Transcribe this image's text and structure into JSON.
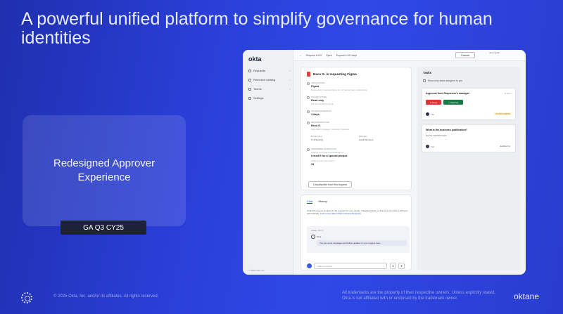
{
  "headline": "A powerful unified platform to simplify governance for human identities",
  "feature_card": {
    "title": "Redesigned Approver Experience",
    "badge": "GA Q3 CY25"
  },
  "footer": {
    "copyright": "© 2025 Okta, Inc. and/or its affiliates. All rights reserved.",
    "trademark": "All trademarks are the property of their respective owners. Unless explicitly stated, Okta is not affiliated with or endorsed by the trademark owner.",
    "brand": "oktane"
  },
  "app": {
    "logo": "okta",
    "nav": [
      {
        "label": "Requests"
      },
      {
        "label": "Resource catalog"
      },
      {
        "label": "Teams"
      },
      {
        "label": "Settings"
      }
    ],
    "side_footer": "© 2025 Okta, Inc.",
    "topbar": {
      "back": "←",
      "request_id": "Request #123",
      "status": "Open",
      "expires": "Expires in 30 days",
      "cancel": "Cancel",
      "user": "Jane Smith"
    },
    "request": {
      "title": "Beca G. is requesting Figma",
      "fields": [
        {
          "label": "APPLICATION",
          "value": "Figma",
          "sub": "Requesting to access figma for our design team onboarding"
        },
        {
          "label": "ACCESS LEVEL",
          "value": "Read only",
          "sub": "For the contractor group"
        },
        {
          "label": "ACCESS DURATION",
          "value": "3 days",
          "sub": ""
        },
        {
          "label": "REQUESTED FOR",
          "value": "Beca G.",
          "sub": "Web Editor manager, Customer Success"
        }
      ],
      "department_label": "Department",
      "department_value": "IT & Security",
      "manager_label": "Manager",
      "manager_value": "Anna Simmons",
      "questions_label": "ANSWERED QUESTIONS",
      "q1": "What is your business justification?",
      "a1": "I need it for a special project.",
      "q2": "What is your cost center?",
      "a2": "31",
      "unsubscribe": "Unsubscribe from this request"
    },
    "chat": {
      "tab_chat": "Chat",
      "tab_history": "History",
      "description": "Chat with anyone involved in the request for more details. Integrated Slack or Teams conversations will sync automatically.",
      "link": "Learn more about Chat in Access Requests",
      "date": "Friday, Oct 3",
      "author": "Okta",
      "message": "You can send messages and follow updates to your request here.",
      "input_placeholder": "Add a comment",
      "attach": "$",
      "send": "➤"
    },
    "tasks": {
      "title": "Tasks",
      "only_mine": "Show only tasks assigned to you",
      "items": [
        {
          "title": "Approval from Requester's manager",
          "due": "6 Oct 7",
          "deny": "✕ Deny",
          "approve": "✓ Approve",
          "assignee": "You",
          "status": "IN PROGRESS"
        },
        {
          "title": "What is the business justification?",
          "question": "For the special project.",
          "assignee": "You",
          "status": "Justified by"
        }
      ]
    }
  }
}
